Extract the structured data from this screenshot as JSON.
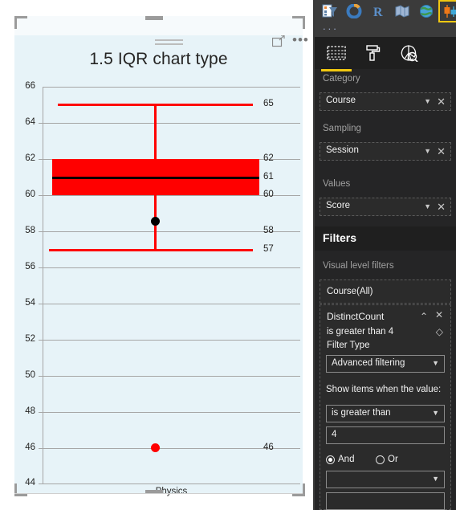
{
  "visual": {
    "title": "1.5 IQR chart type",
    "header_icons": [
      {
        "name": "focus-mode-icon",
        "label": "Focus mode"
      },
      {
        "name": "more-options-icon",
        "label": "..."
      }
    ]
  },
  "chart_data": {
    "type": "box",
    "title": "1.5 IQR chart type",
    "xlabel": "",
    "ylabel": "",
    "categories": [
      "Physics"
    ],
    "ylim": [
      44,
      66
    ],
    "ytick_step": 2,
    "yticks": [
      44,
      46,
      48,
      50,
      52,
      54,
      56,
      58,
      60,
      62,
      64,
      66
    ],
    "grid": true,
    "legend": "none",
    "series": [
      {
        "name": "Physics",
        "upper_whisker": 65,
        "q3": 62,
        "median": 61,
        "q1": 60,
        "lower_whisker": 57,
        "mean": 58.3,
        "outliers": [
          46
        ]
      }
    ],
    "data_labels": [
      {
        "value": "65",
        "series_point": "upper_whisker"
      },
      {
        "value": "62",
        "series_point": "q3"
      },
      {
        "value": "61",
        "series_point": "median"
      },
      {
        "value": "60",
        "series_point": "q1"
      },
      {
        "value": "58",
        "series_point": "mean"
      },
      {
        "value": "57",
        "series_point": "lower_whisker"
      },
      {
        "value": "46",
        "series_point": "outlier"
      }
    ],
    "colors": {
      "box_fill": "#ff0000",
      "whisker": "#ff0000",
      "median": "#000000",
      "mean_marker": "#000000",
      "outlier": "#ff0000",
      "plot_background": "#e7f3f8",
      "gridline": "#a6a6a6"
    }
  },
  "axis": {
    "y_labels": [
      "66",
      "64",
      "62",
      "60",
      "58",
      "56",
      "54",
      "52",
      "50",
      "48",
      "46",
      "44"
    ],
    "x_label": "Physics"
  },
  "pane": {
    "gallery": {
      "icons": [
        {
          "name": "funnel-chart-icon",
          "label": "Funnel chart"
        },
        {
          "name": "donut-chart-icon",
          "label": "Donut chart"
        },
        {
          "name": "r-script-visual-icon",
          "label": "R script visual"
        },
        {
          "name": "shape-map-icon",
          "label": "Shape map"
        },
        {
          "name": "globe-map-icon",
          "label": "Globe map"
        },
        {
          "name": "box-whisker-visual-icon",
          "label": "Box and whisker chart"
        }
      ],
      "more_label": "..."
    },
    "tabs": [
      {
        "name": "fields-tab",
        "label": "Fields",
        "selected": true
      },
      {
        "name": "format-tab",
        "label": "Format",
        "selected": false
      },
      {
        "name": "analytics-tab",
        "label": "Analytics",
        "selected": false
      }
    ],
    "wells": [
      {
        "label": "Category",
        "value": "Course"
      },
      {
        "label": "Sampling",
        "value": "Session"
      },
      {
        "label": "Values",
        "value": "Score"
      }
    ],
    "filters": {
      "title": "Filters",
      "subtitle": "Visual level filters",
      "cards": [
        {
          "title": "Course(All)"
        },
        {
          "title": "DistinctCount",
          "condition": "is greater than 4",
          "filter_type_label": "Filter Type",
          "filter_type_value": "Advanced filtering",
          "show_items_label": "Show items when the value:",
          "operator": "is greater than",
          "operand": "4",
          "and_label": "And",
          "or_label": "Or",
          "second_operator": "",
          "second_operand": ""
        }
      ]
    }
  }
}
